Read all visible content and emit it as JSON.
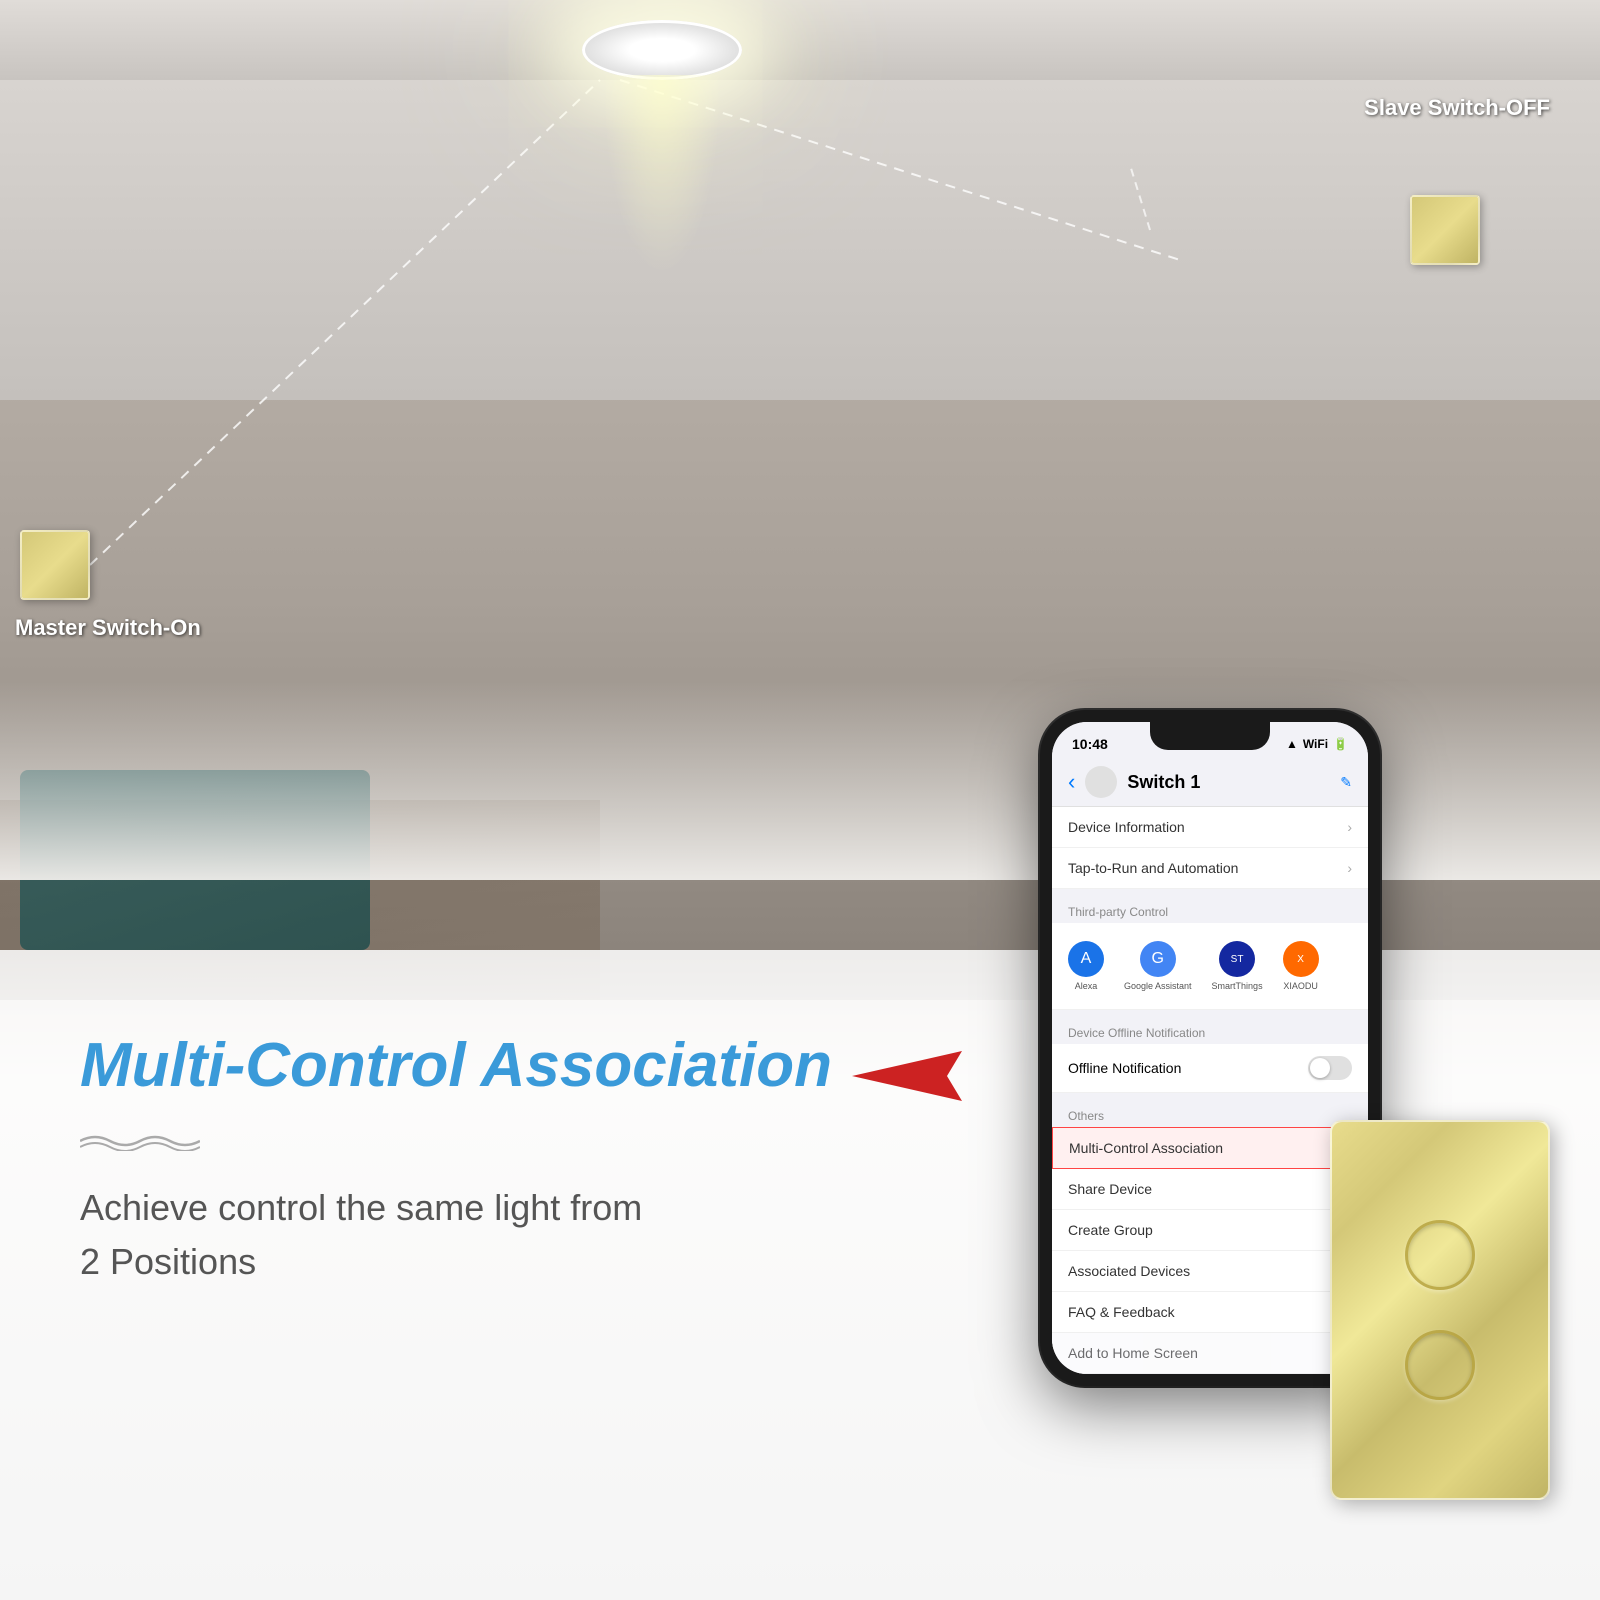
{
  "page": {
    "background": {
      "alt": "Smart home room background with ceiling light"
    }
  },
  "labels": {
    "slave_switch": "Slave Switch-OFF",
    "master_switch": "Master Switch-On",
    "multi_control_title": "Multi-Control Association",
    "description_line1": "Achieve control the same light from",
    "description_line2": "2 Positions"
  },
  "phone": {
    "status_bar": {
      "time": "10:48",
      "signal": "▲▲▲",
      "wifi": "WiFi",
      "battery": "●●"
    },
    "nav": {
      "back": "‹",
      "title": "Switch 1",
      "edit_icon": "✎"
    },
    "menu_items": [
      {
        "label": "Device Information",
        "has_chevron": true,
        "highlighted": false
      },
      {
        "label": "Tap-to-Run and Automation",
        "has_chevron": true,
        "highlighted": false
      },
      {
        "separator": true,
        "section_label": "Third-party Control"
      },
      {
        "label": "Device Offline Notification",
        "section_label": "Device Offline Notification",
        "has_chevron": false,
        "highlighted": false
      },
      {
        "label": "Offline Notification",
        "is_toggle": true,
        "highlighted": false
      },
      {
        "separator": true,
        "section_label": "Others"
      },
      {
        "label": "Multi-Control Association",
        "has_chevron": true,
        "highlighted": true
      },
      {
        "label": "Share Device",
        "has_chevron": true,
        "highlighted": false
      },
      {
        "label": "Create Group",
        "has_chevron": true,
        "highlighted": false
      },
      {
        "label": "Associated Devices",
        "has_chevron": true,
        "highlighted": false
      },
      {
        "label": "FAQ & Feedback",
        "has_chevron": true,
        "highlighted": false
      },
      {
        "label": "Add to Home Screen",
        "has_chevron": true,
        "highlighted": false
      }
    ],
    "third_party": [
      {
        "name": "Alexa",
        "icon": "A",
        "color": "alexa"
      },
      {
        "name": "Google Assistant",
        "icon": "G",
        "color": "google"
      },
      {
        "name": "SmartThings",
        "icon": "ST",
        "color": "smartthings"
      },
      {
        "name": "XIAODU",
        "icon": "X",
        "color": "xiaodu"
      }
    ]
  }
}
